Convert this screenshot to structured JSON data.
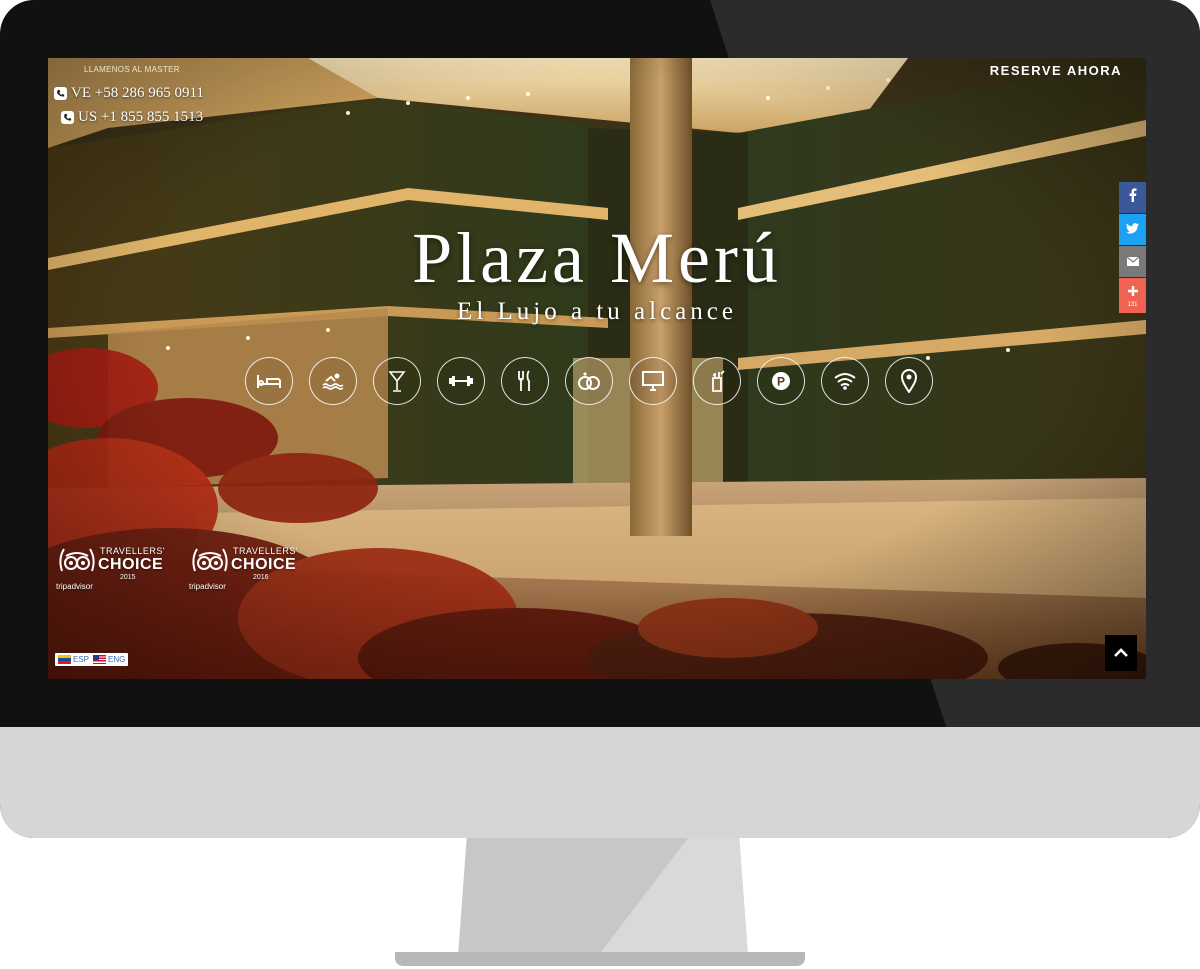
{
  "header": {
    "call_label": "LLAMENOS AL MASTER",
    "phone_ve": "VE +58 286 965 0911",
    "phone_us": "US +1 855 855 1513",
    "reserve_label": "RESERVE AHORA"
  },
  "hero": {
    "title": "Plaza Merú",
    "subtitle": "El Lujo a tu alcance"
  },
  "amenities": [
    "bed-icon",
    "pool-icon",
    "cocktail-icon",
    "gym-icon",
    "restaurant-icon",
    "wedding-rings-icon",
    "computer-icon",
    "room-service-icon",
    "parking-icon",
    "wifi-icon",
    "location-pin-icon"
  ],
  "social": {
    "items": [
      "facebook-icon",
      "twitter-icon",
      "email-icon",
      "plus-icon"
    ],
    "share_count": "131"
  },
  "awards": [
    {
      "line1": "TRAVELLERS'",
      "line2": "CHOICE",
      "year": "2015",
      "brand": "tripadvisor"
    },
    {
      "line1": "TRAVELLERS'",
      "line2": "CHOICE",
      "year": "2016",
      "brand": "tripadvisor"
    }
  ],
  "language": {
    "esp": "ESP",
    "eng": "ENG"
  },
  "colors": {
    "facebook": "#3b5998",
    "twitter": "#1da1f2",
    "email": "#7a7a7a",
    "share": "#f06252"
  }
}
